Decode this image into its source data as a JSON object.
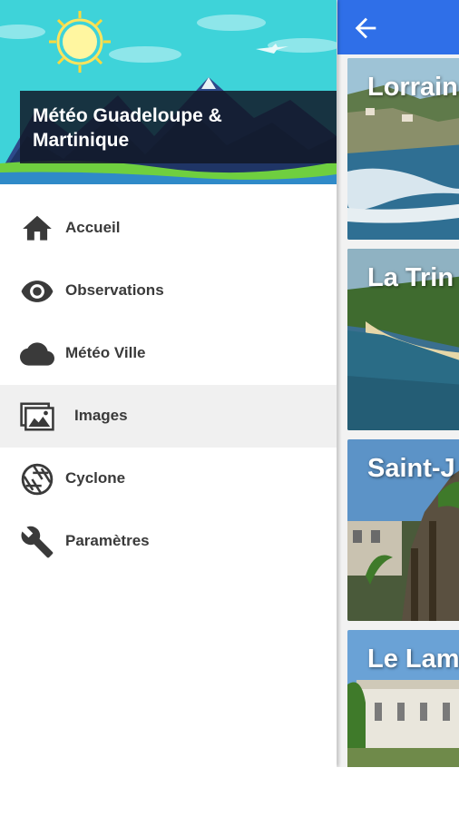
{
  "drawer": {
    "app_title_line1": "Météo Guadeloupe &",
    "app_title_line2": "Martinique",
    "items": [
      {
        "label": "Accueil",
        "icon": "home-icon"
      },
      {
        "label": "Observations",
        "icon": "eye-icon"
      },
      {
        "label": "Météo Ville",
        "icon": "cloud-icon"
      },
      {
        "label": "Images",
        "icon": "images-icon",
        "selected": true
      },
      {
        "label": "Cyclone",
        "icon": "aperture-icon"
      },
      {
        "label": "Paramètres",
        "icon": "wrench-icon"
      }
    ]
  },
  "app": {
    "back_icon": "arrow-left-icon",
    "accent_color": "#2f6fe8",
    "cards": [
      {
        "title": "Lorrain"
      },
      {
        "title": "La Trin"
      },
      {
        "title": "Saint-J"
      },
      {
        "title": "Le Lam"
      }
    ]
  }
}
